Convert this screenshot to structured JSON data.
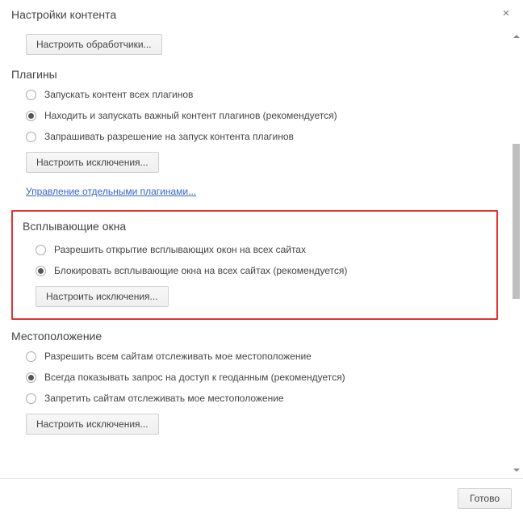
{
  "header": {
    "title": "Настройки контента"
  },
  "handlers": {
    "configure_btn": "Настроить обработчики..."
  },
  "plugins": {
    "title": "Плагины",
    "opt_run_all": "Запускать контент всех плагинов",
    "opt_detect": "Находить и запускать важный контент плагинов (рекомендуется)",
    "opt_ask": "Запрашивать разрешение на запуск контента плагинов",
    "exceptions_btn": "Настроить исключения...",
    "manage_link": "Управление отдельными плагинами..."
  },
  "popups": {
    "title": "Всплывающие окна",
    "opt_allow": "Разрешить открытие всплывающих окон на всех сайтах",
    "opt_block": "Блокировать всплывающие окна на всех сайтах (рекомендуется)",
    "exceptions_btn": "Настроить исключения..."
  },
  "location": {
    "title": "Местоположение",
    "opt_allow": "Разрешить всем сайтам отслеживать мое местоположение",
    "opt_ask": "Всегда показывать запрос на доступ к геоданным (рекомендуется)",
    "opt_block": "Запретить сайтам отслеживать мое местоположение",
    "exceptions_btn": "Настроить исключения..."
  },
  "footer": {
    "done": "Готово"
  }
}
